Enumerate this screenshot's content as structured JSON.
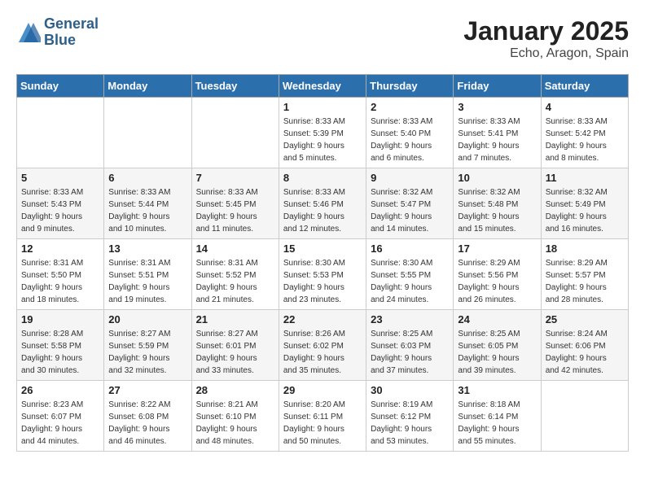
{
  "logo": {
    "line1": "General",
    "line2": "Blue"
  },
  "title": "January 2025",
  "subtitle": "Echo, Aragon, Spain",
  "days_of_week": [
    "Sunday",
    "Monday",
    "Tuesday",
    "Wednesday",
    "Thursday",
    "Friday",
    "Saturday"
  ],
  "weeks": [
    [
      {
        "day": "",
        "info": ""
      },
      {
        "day": "",
        "info": ""
      },
      {
        "day": "",
        "info": ""
      },
      {
        "day": "1",
        "info": "Sunrise: 8:33 AM\nSunset: 5:39 PM\nDaylight: 9 hours\nand 5 minutes."
      },
      {
        "day": "2",
        "info": "Sunrise: 8:33 AM\nSunset: 5:40 PM\nDaylight: 9 hours\nand 6 minutes."
      },
      {
        "day": "3",
        "info": "Sunrise: 8:33 AM\nSunset: 5:41 PM\nDaylight: 9 hours\nand 7 minutes."
      },
      {
        "day": "4",
        "info": "Sunrise: 8:33 AM\nSunset: 5:42 PM\nDaylight: 9 hours\nand 8 minutes."
      }
    ],
    [
      {
        "day": "5",
        "info": "Sunrise: 8:33 AM\nSunset: 5:43 PM\nDaylight: 9 hours\nand 9 minutes."
      },
      {
        "day": "6",
        "info": "Sunrise: 8:33 AM\nSunset: 5:44 PM\nDaylight: 9 hours\nand 10 minutes."
      },
      {
        "day": "7",
        "info": "Sunrise: 8:33 AM\nSunset: 5:45 PM\nDaylight: 9 hours\nand 11 minutes."
      },
      {
        "day": "8",
        "info": "Sunrise: 8:33 AM\nSunset: 5:46 PM\nDaylight: 9 hours\nand 12 minutes."
      },
      {
        "day": "9",
        "info": "Sunrise: 8:32 AM\nSunset: 5:47 PM\nDaylight: 9 hours\nand 14 minutes."
      },
      {
        "day": "10",
        "info": "Sunrise: 8:32 AM\nSunset: 5:48 PM\nDaylight: 9 hours\nand 15 minutes."
      },
      {
        "day": "11",
        "info": "Sunrise: 8:32 AM\nSunset: 5:49 PM\nDaylight: 9 hours\nand 16 minutes."
      }
    ],
    [
      {
        "day": "12",
        "info": "Sunrise: 8:31 AM\nSunset: 5:50 PM\nDaylight: 9 hours\nand 18 minutes."
      },
      {
        "day": "13",
        "info": "Sunrise: 8:31 AM\nSunset: 5:51 PM\nDaylight: 9 hours\nand 19 minutes."
      },
      {
        "day": "14",
        "info": "Sunrise: 8:31 AM\nSunset: 5:52 PM\nDaylight: 9 hours\nand 21 minutes."
      },
      {
        "day": "15",
        "info": "Sunrise: 8:30 AM\nSunset: 5:53 PM\nDaylight: 9 hours\nand 23 minutes."
      },
      {
        "day": "16",
        "info": "Sunrise: 8:30 AM\nSunset: 5:55 PM\nDaylight: 9 hours\nand 24 minutes."
      },
      {
        "day": "17",
        "info": "Sunrise: 8:29 AM\nSunset: 5:56 PM\nDaylight: 9 hours\nand 26 minutes."
      },
      {
        "day": "18",
        "info": "Sunrise: 8:29 AM\nSunset: 5:57 PM\nDaylight: 9 hours\nand 28 minutes."
      }
    ],
    [
      {
        "day": "19",
        "info": "Sunrise: 8:28 AM\nSunset: 5:58 PM\nDaylight: 9 hours\nand 30 minutes."
      },
      {
        "day": "20",
        "info": "Sunrise: 8:27 AM\nSunset: 5:59 PM\nDaylight: 9 hours\nand 32 minutes."
      },
      {
        "day": "21",
        "info": "Sunrise: 8:27 AM\nSunset: 6:01 PM\nDaylight: 9 hours\nand 33 minutes."
      },
      {
        "day": "22",
        "info": "Sunrise: 8:26 AM\nSunset: 6:02 PM\nDaylight: 9 hours\nand 35 minutes."
      },
      {
        "day": "23",
        "info": "Sunrise: 8:25 AM\nSunset: 6:03 PM\nDaylight: 9 hours\nand 37 minutes."
      },
      {
        "day": "24",
        "info": "Sunrise: 8:25 AM\nSunset: 6:05 PM\nDaylight: 9 hours\nand 39 minutes."
      },
      {
        "day": "25",
        "info": "Sunrise: 8:24 AM\nSunset: 6:06 PM\nDaylight: 9 hours\nand 42 minutes."
      }
    ],
    [
      {
        "day": "26",
        "info": "Sunrise: 8:23 AM\nSunset: 6:07 PM\nDaylight: 9 hours\nand 44 minutes."
      },
      {
        "day": "27",
        "info": "Sunrise: 8:22 AM\nSunset: 6:08 PM\nDaylight: 9 hours\nand 46 minutes."
      },
      {
        "day": "28",
        "info": "Sunrise: 8:21 AM\nSunset: 6:10 PM\nDaylight: 9 hours\nand 48 minutes."
      },
      {
        "day": "29",
        "info": "Sunrise: 8:20 AM\nSunset: 6:11 PM\nDaylight: 9 hours\nand 50 minutes."
      },
      {
        "day": "30",
        "info": "Sunrise: 8:19 AM\nSunset: 6:12 PM\nDaylight: 9 hours\nand 53 minutes."
      },
      {
        "day": "31",
        "info": "Sunrise: 8:18 AM\nSunset: 6:14 PM\nDaylight: 9 hours\nand 55 minutes."
      },
      {
        "day": "",
        "info": ""
      }
    ]
  ]
}
